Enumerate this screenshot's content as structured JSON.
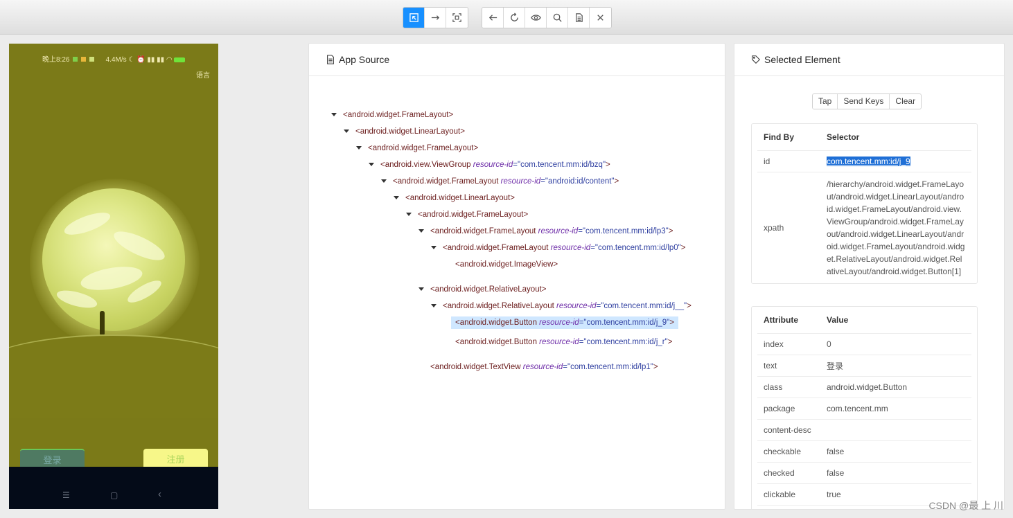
{
  "toolbar": {
    "mode_buttons": [
      "select-element-icon",
      "swipe-icon",
      "tap-by-coordinates-icon"
    ],
    "action_buttons": [
      "back-icon",
      "refresh-icon",
      "eye-icon",
      "search-icon",
      "copy-xml-icon",
      "close-icon"
    ]
  },
  "device": {
    "status_time": "晚上8:26",
    "status_speed": "4.4M/s",
    "language_label": "语言",
    "login_label": "登录",
    "register_label": "注册",
    "nav_menu": "☰",
    "nav_home": "▢",
    "nav_back": "‹"
  },
  "source": {
    "title": "App Source",
    "nodes": [
      {
        "tag": "<android.widget.FrameLayout>",
        "attr": "",
        "val": "",
        "end": ""
      },
      {
        "tag": "<android.widget.LinearLayout>",
        "attr": "",
        "val": "",
        "end": ""
      },
      {
        "tag": "<android.widget.FrameLayout>",
        "attr": "",
        "val": "",
        "end": ""
      },
      {
        "tag": "<android.view.ViewGroup",
        "attr": "resource-id",
        "val": "=\"com.tencent.mm:id/bzq\"",
        "end": ">"
      },
      {
        "tag": "<android.widget.FrameLayout",
        "attr": "resource-id",
        "val": "=\"android:id/content\"",
        "end": ">"
      },
      {
        "tag": "<android.widget.LinearLayout>",
        "attr": "",
        "val": "",
        "end": ""
      },
      {
        "tag": "<android.widget.FrameLayout>",
        "attr": "",
        "val": "",
        "end": ""
      },
      {
        "tag": "<android.widget.FrameLayout",
        "attr": "resource-id",
        "val": "=\"com.tencent.mm:id/lp3\"",
        "end": ">"
      },
      {
        "tag": "<android.widget.FrameLayout",
        "attr": "resource-id",
        "val": "=\"com.tencent.mm:id/lp0\"",
        "end": ">"
      },
      {
        "tag": "<android.widget.ImageView>",
        "attr": "",
        "val": "",
        "end": ""
      },
      {
        "tag": "<android.widget.RelativeLayout>",
        "attr": "",
        "val": "",
        "end": ""
      },
      {
        "tag": "<android.widget.RelativeLayout",
        "attr": "resource-id",
        "val": "=\"com.tencent.mm:id/j__\"",
        "end": ">"
      },
      {
        "tag": "<android.widget.Button",
        "attr": "resource-id",
        "val": "=\"com.tencent.mm:id/j_9\"",
        "end": ">"
      },
      {
        "tag": "<android.widget.Button",
        "attr": "resource-id",
        "val": "=\"com.tencent.mm:id/j_r\"",
        "end": ">"
      },
      {
        "tag": "<android.widget.TextView",
        "attr": "resource-id",
        "val": "=\"com.tencent.mm:id/lp1\"",
        "end": ">"
      }
    ]
  },
  "selected": {
    "title": "Selected Element",
    "actions": [
      "Tap",
      "Send Keys",
      "Clear"
    ],
    "find_by_header": "Find By",
    "selector_header": "Selector",
    "id_label": "id",
    "id_value": "com.tencent.mm:id/j_9",
    "xpath_label": "xpath",
    "xpath_value": "/hierarchy/android.widget.FrameLayout/android.widget.LinearLayout/android.widget.FrameLayout/android.view.ViewGroup/android.widget.FrameLayout/android.widget.LinearLayout/android.widget.FrameLayout/android.widget.RelativeLayout/android.widget.RelativeLayout/android.widget.Button[1]",
    "attribute_header": "Attribute",
    "value_header": "Value",
    "attributes": [
      {
        "name": "index",
        "value": "0"
      },
      {
        "name": "text",
        "value": "登录"
      },
      {
        "name": "class",
        "value": "android.widget.Button"
      },
      {
        "name": "package",
        "value": "com.tencent.mm"
      },
      {
        "name": "content-desc",
        "value": ""
      },
      {
        "name": "checkable",
        "value": "false"
      },
      {
        "name": "checked",
        "value": "false"
      },
      {
        "name": "clickable",
        "value": "true"
      }
    ]
  },
  "watermark": "CSDN @最 上 川"
}
